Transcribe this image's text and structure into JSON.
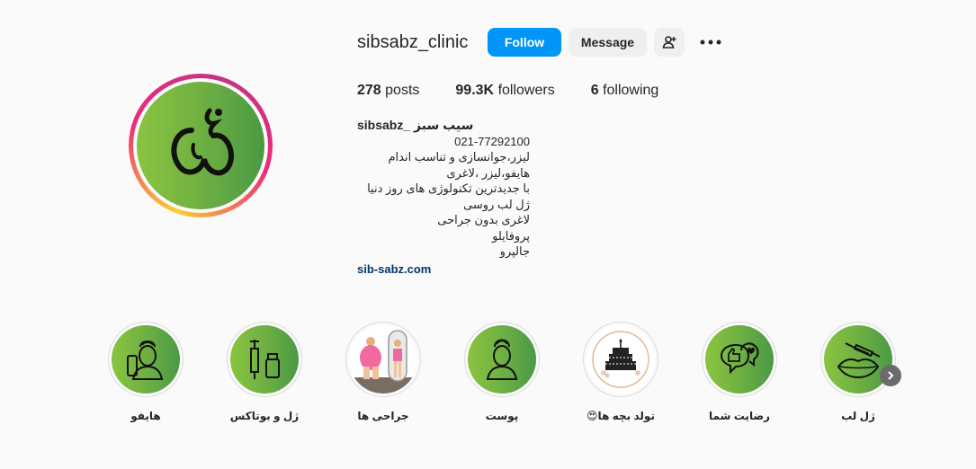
{
  "profile": {
    "username": "sibsabz_clinic",
    "follow_label": "Follow",
    "message_label": "Message",
    "add_user_icon": "add-user-icon",
    "more_icon": "more-options-icon"
  },
  "stats": {
    "posts_count": "278",
    "posts_label": "posts",
    "followers_count": "99.3K",
    "followers_label": "followers",
    "following_count": "6",
    "following_label": "following"
  },
  "bio": {
    "name": "sibsabz_ سیب سبز",
    "lines": [
      "021-77292100",
      "لیزر،جوانسازی و تناسب اندام",
      "هایفو،لیزر ،لاغری",
      "با جدیدترین تکنولوژی های روز دنیا",
      "ژل لب روسی",
      "لاغری بدون جراحی",
      "پروفایلو",
      "جالپرو"
    ],
    "link": "sib-sabz.com"
  },
  "highlights": [
    {
      "label": "هایفو",
      "icon": "face-device-icon"
    },
    {
      "label": "ژل و بوتاکس",
      "icon": "syringe-vial-icon"
    },
    {
      "label": "جراحی ها",
      "icon": "before-after-photo"
    },
    {
      "label": "پوست",
      "icon": "face-profile-icon"
    },
    {
      "label": "تولد بچه ها😍",
      "icon": "cake-icon"
    },
    {
      "label": "رضایت شما",
      "icon": "thumbs-up-heart-icon"
    },
    {
      "label": "ژل لب",
      "icon": "lips-syringe-icon"
    }
  ],
  "next_icon": "chevron-right-icon"
}
